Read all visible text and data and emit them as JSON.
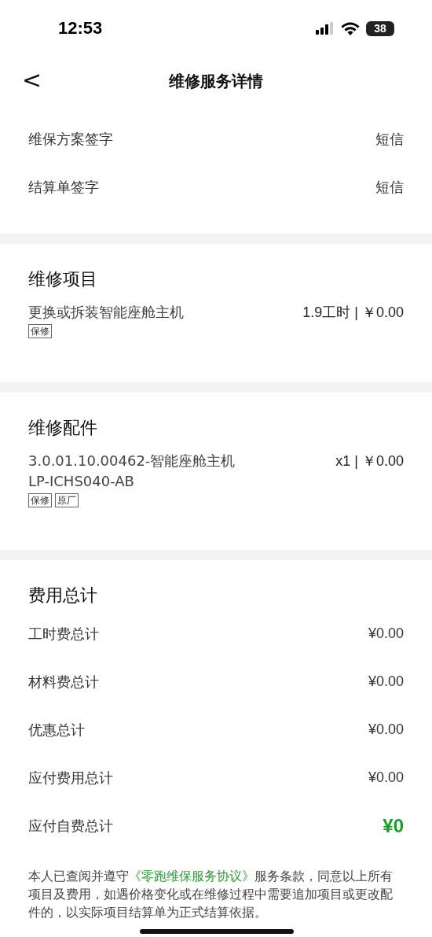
{
  "status_bar": {
    "time": "12:53",
    "battery": "38"
  },
  "nav": {
    "back": "<",
    "title": "维修服务详情"
  },
  "signatures": [
    {
      "label": "维保方案签字",
      "value": "短信"
    },
    {
      "label": "结算单签字",
      "value": "短信"
    }
  ],
  "repair_items": {
    "title": "维修项目",
    "items": [
      {
        "name": "更换或拆装智能座舱主机",
        "amount": "1.9工时 | ￥0.00",
        "tags": [
          "保修"
        ]
      }
    ]
  },
  "parts": {
    "title": "维修配件",
    "items": [
      {
        "name": "3.0.01.10.00462-智能座舱主机\nLP-ICHS040-AB",
        "amount": "x1 | ￥0.00",
        "tags": [
          "保修",
          "原厂"
        ]
      }
    ]
  },
  "totals": {
    "title": "费用总计",
    "rows": [
      {
        "label": "工时费总计",
        "value": "¥0.00",
        "kind": "plain"
      },
      {
        "label": "材料费总计",
        "value": "¥0.00",
        "kind": "plain"
      },
      {
        "label": "优惠总计",
        "value": "¥0.00",
        "kind": "plain"
      },
      {
        "label": "应付费用总计",
        "value": "¥0.00",
        "kind": "plain"
      },
      {
        "label": "应付自费总计",
        "value": "¥0",
        "kind": "highlight"
      }
    ]
  },
  "agreement": {
    "before": "本人已查阅并遵守",
    "link": "《零跑维保服务协议》",
    "after": "服务条款，同意以上所有项目及费用，如遇价格变化或在维修过程中需要追加项目或更改配件的，以实际项目结算单为正式结算依据。"
  }
}
